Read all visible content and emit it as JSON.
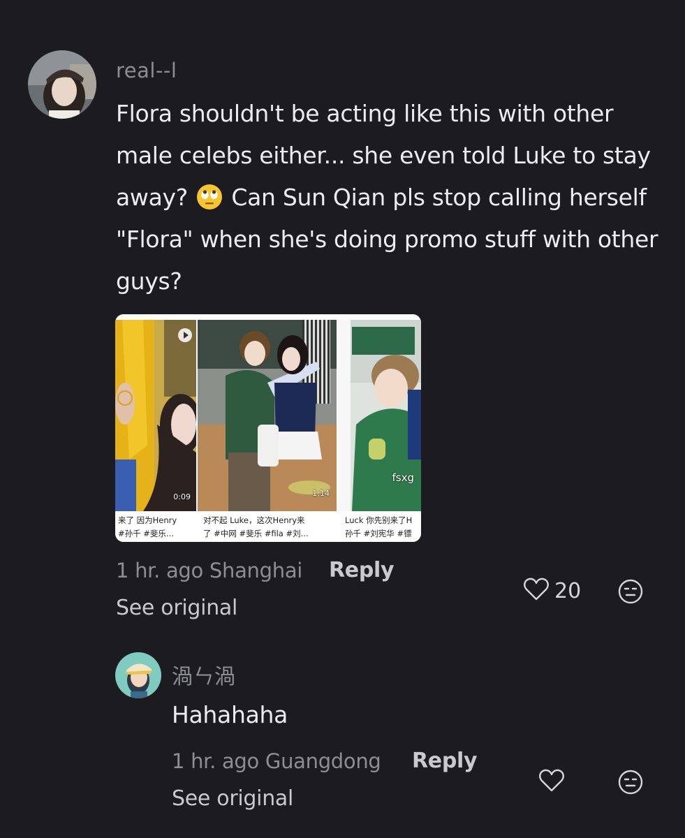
{
  "comment": {
    "username": "real--l",
    "text_line1": "Flora shouldn't be acting like this with other",
    "text_line2": "male celebs either... she even told Luke to stay",
    "text_line3_pre": "away?",
    "text_line3_post": "Can Sun Qian pls stop calling herself",
    "text_line4": "\"Flora\" when she's doing promo stuff with other",
    "text_line5": "guys?",
    "inline_emoji": "rolling-eyes-emoji",
    "thumbnails": [
      {
        "duration": "0:09",
        "caption_line1": "来了 因为Henry",
        "caption_line2": "#孙千 #斐乐...",
        "has_play": true
      },
      {
        "duration": "1:14",
        "caption_line1": "对不起 Luke，这次Henry来",
        "caption_line2": "了 #中网 #斐乐 #fila #刘...",
        "has_play": true
      },
      {
        "duration": "",
        "overlay_text": "fsxg",
        "caption_line1": "Luck 你先别来了H",
        "caption_line2": "孙千 #刘宪华 #镖",
        "has_play": false
      }
    ],
    "time": "1 hr. ago",
    "location": "Shanghai",
    "reply_label": "Reply",
    "see_original_label": "See original",
    "like_count": "20"
  },
  "reply": {
    "username": "渦ㄣ渦",
    "text": "Hahahaha",
    "time": "1 hr. ago",
    "location": "Guangdong",
    "reply_label": "Reply",
    "see_original_label": "See original",
    "like_count": ""
  },
  "colors": {
    "background": "#1b1b20",
    "text_primary": "#ededf0",
    "text_secondary": "#8d8d95"
  }
}
